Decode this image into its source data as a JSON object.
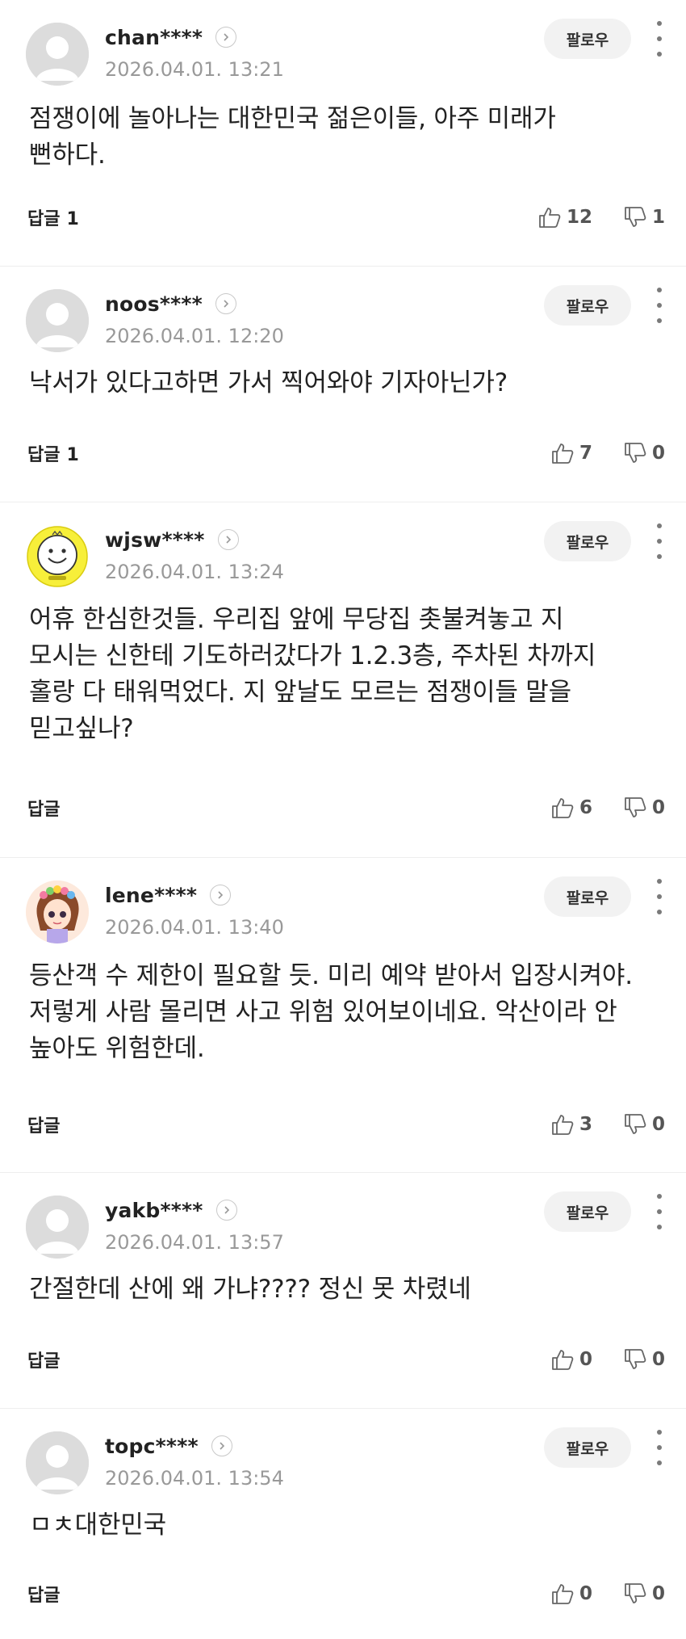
{
  "ui": {
    "follow_label": "팔로우",
    "reply_label": "답글"
  },
  "comments": [
    {
      "username": "chan****",
      "timestamp": "2026.04.01. 13:21",
      "text": "점쟁이에 놀아나는 대한민국 젊은이들, 아주 미래가 뻔하다.",
      "replies": "1",
      "likes": "12",
      "dislikes": "1",
      "avatar": "default-avatar-icon"
    },
    {
      "username": "noos****",
      "timestamp": "2026.04.01. 12:20",
      "text": "낙서가 있다고하면 가서 찍어와야 기자아닌가?",
      "replies": "1",
      "likes": "7",
      "dislikes": "0",
      "avatar": "default-avatar-icon"
    },
    {
      "username": "wjsw****",
      "timestamp": "2026.04.01. 13:24",
      "text": "어휴 한심한것들. 우리집 앞에 무당집 촛불켜놓고 지 모시는 신한테 기도하러갔다가 1.2.3층, 주차된 차까지 홀랑 다 태워먹었다. 지 앞날도 모르는 점쟁이들 말을 믿고싶나?",
      "replies": "",
      "likes": "6",
      "dislikes": "0",
      "avatar": "smiley-avatar-icon"
    },
    {
      "username": "lene****",
      "timestamp": "2026.04.01. 13:40",
      "text": "등산객 수 제한이 필요할 듯. 미리 예약 받아서 입장시켜야. 저렇게 사람 몰리면 사고 위험 있어보이네요. 악산이라 안 높아도 위험한데.",
      "replies": "",
      "likes": "3",
      "dislikes": "0",
      "avatar": "girl-avatar-icon"
    },
    {
      "username": "yakb****",
      "timestamp": "2026.04.01. 13:57",
      "text": "간절한데 산에 왜 가냐???? 정신 못 차렸네",
      "replies": "",
      "likes": "0",
      "dislikes": "0",
      "avatar": "default-avatar-icon"
    },
    {
      "username": "topc****",
      "timestamp": "2026.04.01. 13:54",
      "text": "ㅁㅊ대한민국",
      "replies": "",
      "likes": "0",
      "dislikes": "0",
      "avatar": "default-avatar-icon"
    }
  ],
  "colors": {
    "muted": "#999999",
    "follow_bg": "#f2f2f2",
    "avatar_default": "#dcdcdc",
    "smiley_yellow": "#f7ef3a"
  }
}
